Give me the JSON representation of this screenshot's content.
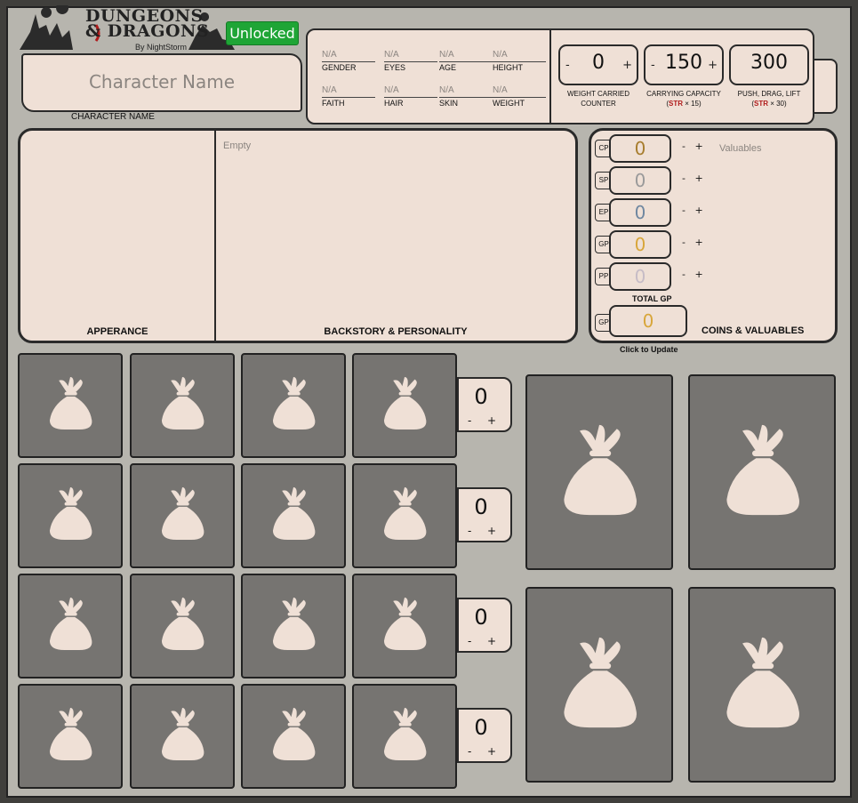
{
  "logo": {
    "title_line1": "DUNGEONS",
    "title_line2": "& DRAGONS",
    "subtitle": "By NightStorm"
  },
  "lock_button": "Unlocked",
  "character": {
    "name_placeholder": "Character Name",
    "name_label": "CHARACTER NAME"
  },
  "details": [
    {
      "label": "GENDER",
      "value": "N/A"
    },
    {
      "label": "EYES",
      "value": "N/A"
    },
    {
      "label": "AGE",
      "value": "N/A"
    },
    {
      "label": "HEIGHT",
      "value": "N/A"
    },
    {
      "label": "FAITH",
      "value": "N/A"
    },
    {
      "label": "HAIR",
      "value": "N/A"
    },
    {
      "label": "SKIN",
      "value": "N/A"
    },
    {
      "label": "WEIGHT",
      "value": "N/A"
    }
  ],
  "weight": {
    "carried": {
      "value": "0",
      "label": "WEIGHT CARRIED",
      "sublabel": "COUNTER",
      "minus": "-",
      "plus": "+"
    },
    "capacity": {
      "value": "150",
      "label": "CARRYING CAPACITY",
      "formula_str": "STR",
      "formula_rest": " × 15)",
      "formula_open": "(",
      "minus": "-",
      "plus": "+"
    },
    "push": {
      "value": "300",
      "label": "PUSH, DRAG, LIFT",
      "formula_str": "STR",
      "formula_rest": " × 30)",
      "formula_open": "("
    }
  },
  "story": {
    "appearance_label": "APPERANCE",
    "backstory_label": "BACKSTORY & PERSONALITY",
    "backstory_placeholder": "Empty"
  },
  "coins": {
    "items": [
      {
        "abbr": "CP",
        "value": "0",
        "color": "#a77d2e"
      },
      {
        "abbr": "SP",
        "value": "0",
        "color": "#9a9a9a"
      },
      {
        "abbr": "EP",
        "value": "0",
        "color": "#6f87a0"
      },
      {
        "abbr": "GP",
        "value": "0",
        "color": "#d8a63a"
      },
      {
        "abbr": "PP",
        "value": "0",
        "color": "#c6bcc6"
      }
    ],
    "minus": "-",
    "plus": "+",
    "valuables_placeholder": "Valuables",
    "total_label": "TOTAL GP",
    "total": {
      "abbr": "GP",
      "value": "0",
      "color": "#d8a63a"
    },
    "section_label": "COINS & VALUABLES",
    "update_hint": "Click to Update"
  },
  "inventory": {
    "row_counters": [
      {
        "value": "0",
        "minus": "-",
        "plus": "+"
      },
      {
        "value": "0",
        "minus": "-",
        "plus": "+"
      },
      {
        "value": "0",
        "minus": "-",
        "plus": "+"
      },
      {
        "value": "0",
        "minus": "-",
        "plus": "+"
      }
    ],
    "slot_icon": "bag-icon"
  },
  "colors": {
    "parchment": "#efe0d6",
    "slot": "#767471",
    "unlock_green": "#1fa536"
  }
}
